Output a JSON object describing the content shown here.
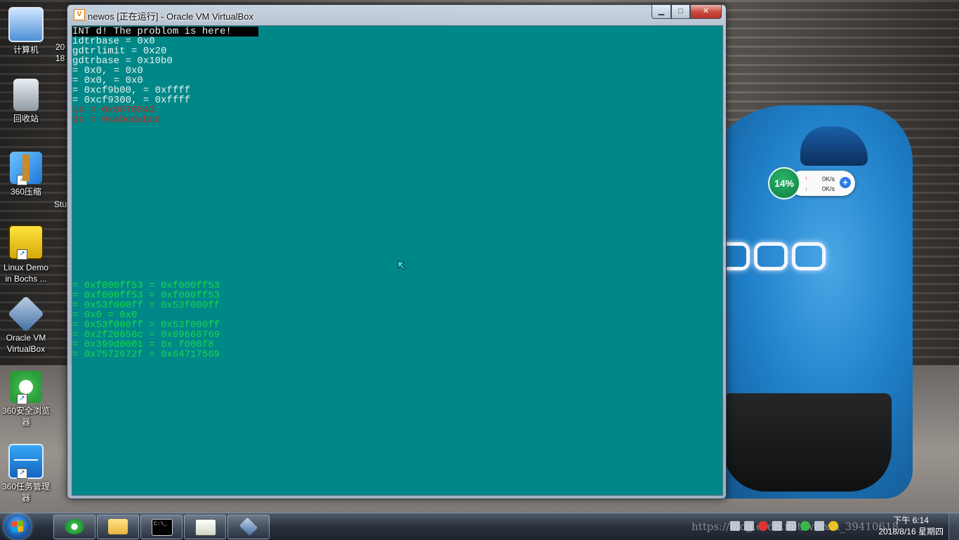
{
  "desktop": {
    "icons": [
      {
        "label": "计算机",
        "icon": "computer-icon"
      },
      {
        "label": "回收站",
        "icon": "recycle-bin-icon"
      },
      {
        "label": "360压缩",
        "icon": "360-zip-icon"
      },
      {
        "label": "Linux Demo in Bochs ...",
        "icon": "bochs-icon"
      },
      {
        "label": "Oracle VM VirtualBox",
        "icon": "virtualbox-icon"
      },
      {
        "label": "360安全浏览器",
        "icon": "360-browser-icon"
      },
      {
        "label": "360任务管理器",
        "icon": "360-task-manager-icon"
      }
    ],
    "peek_texts": [
      "20",
      "18",
      "Stu"
    ]
  },
  "window": {
    "title": "newos [正在运行] - Oracle VM VirtualBox",
    "minimize_glyph": "▁",
    "maximize_glyph": "□",
    "close_glyph": "✕"
  },
  "console": {
    "lines": [
      {
        "text": "INT d! The problom is here!",
        "color": "white"
      },
      {
        "text": "idtrbase = 0x0",
        "color": "white"
      },
      {
        "text": "gdtrlimit = 0x20",
        "color": "white"
      },
      {
        "text": "gdtrbase = 0x10b0",
        "color": "white"
      },
      {
        "text": "= 0x0, = 0x0",
        "color": "white"
      },
      {
        "text": "= 0x0, = 0x0",
        "color": "white"
      },
      {
        "text": "= 0xcf9b00, = 0xffff",
        "color": "white"
      },
      {
        "text": "= 0xcf9300, = 0xffff",
        "color": "white"
      },
      {
        "text": "cs = 0x9876543",
        "color": "red"
      },
      {
        "text": "ds = 0xabcdabcd",
        "color": "red"
      }
    ],
    "green_lines": [
      "= 0xf000ff53 = 0xf000ff53",
      "= 0xf000ff53 = 0xf000ff53",
      "= 0x53f000ff = 0x53f000ff",
      "= 0x0 = 0x0",
      "= 0x53f000ff = 0x53f000ff",
      "= 0x2f20656c = 0x69666769",
      "= 0x399d0001 = 0x f000f8",
      "= 0x7572672f = 0x64717569"
    ]
  },
  "widget": {
    "percent": "14%",
    "upload_speed": "0K/s",
    "download_speed": "0K/s",
    "up_arrow": "↑",
    "down_arrow": "↓",
    "plus": "+"
  },
  "taskbar": {
    "apps": [
      {
        "name": "360-browser",
        "icon": "360-browser-icon"
      },
      {
        "name": "explorer",
        "icon": "folder-icon"
      },
      {
        "name": "cmd",
        "icon": "command-prompt-icon"
      },
      {
        "name": "notepad-plus",
        "icon": "notepad-icon"
      },
      {
        "name": "virtualbox",
        "icon": "virtualbox-icon"
      }
    ],
    "watermark": "https://blog.csdn.net/weixin_39410618",
    "time": "下午 6:14",
    "date": "2018/8/16 星期四"
  }
}
